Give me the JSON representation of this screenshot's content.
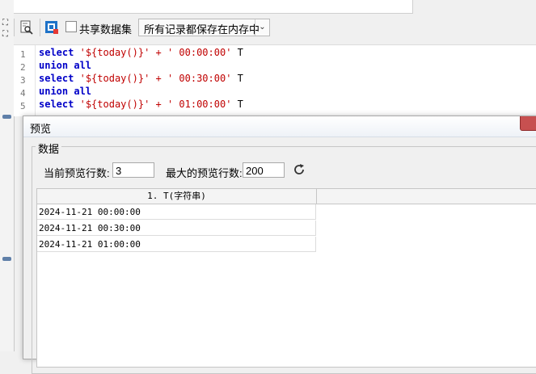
{
  "toolbar": {
    "share_dataset_label": "共享数据集",
    "share_dataset_checked": false,
    "storage_mode_value": "所有记录都保存在内存中"
  },
  "editor": {
    "line_numbers": [
      "1",
      "2",
      "3",
      "4",
      "5"
    ],
    "lines": [
      {
        "kw": "select",
        "str": "'${today()}' + ' 00:00:00'",
        "tail": "T"
      },
      {
        "kw": "union all",
        "str": "",
        "tail": ""
      },
      {
        "kw": "select",
        "str": "'${today()}' + ' 00:30:00'",
        "tail": "T"
      },
      {
        "kw": "union all",
        "str": "",
        "tail": ""
      },
      {
        "kw": "select",
        "str": "'${today()}' + ' 01:00:00'",
        "tail": "T"
      }
    ]
  },
  "dialog": {
    "title": "预览",
    "group_label": "数据",
    "current_rows_label": "当前预览行数:",
    "current_rows_value": "3",
    "max_rows_label": "最大的预览行数:",
    "max_rows_value": "200",
    "grid": {
      "columns": [
        "1. T(字符串)"
      ],
      "rows": [
        [
          "2024-11-21 00:00:00"
        ],
        [
          "2024-11-21 00:30:00"
        ],
        [
          "2024-11-21 01:00:00"
        ]
      ]
    }
  },
  "icons": {
    "preview": "preview-icon",
    "dataset": "dataset-icon",
    "refresh": "refresh-icon",
    "close": "close-icon"
  },
  "colors": {
    "keyword": "#0000c8",
    "string": "#c00000",
    "close_button": "#c75050"
  }
}
